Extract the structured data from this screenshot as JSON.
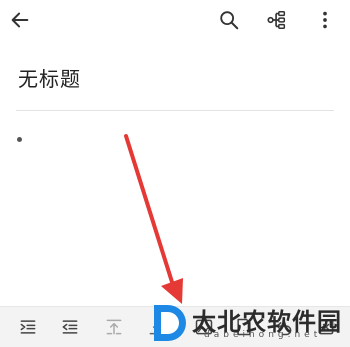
{
  "header": {
    "back_icon": "arrow-left-icon",
    "search_icon": "search-icon",
    "mindmap_icon": "mindmap-icon",
    "more_icon": "more-vertical-icon"
  },
  "document": {
    "title": "无标题"
  },
  "toolbar": {
    "icons": [
      "indent-icon",
      "outdent-icon",
      "move-up-icon",
      "move-down-icon",
      "image-icon",
      "note-icon",
      "undo-icon",
      "delete-icon"
    ]
  },
  "watermark": {
    "text": "太北农软件园",
    "subtext": "dabeinong.net"
  },
  "colors": {
    "annotation_arrow": "#e53935",
    "watermark_blue": "#1e88e5"
  }
}
